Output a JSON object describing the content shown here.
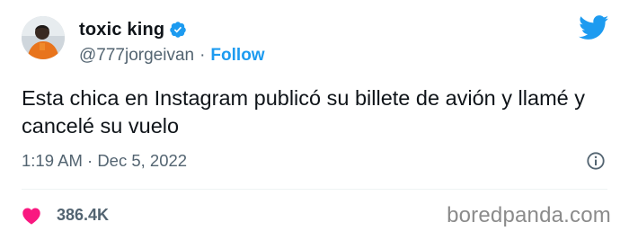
{
  "tweet": {
    "author": {
      "display_name": "toxic king",
      "handle": "@777jorgeivan",
      "separator": "·",
      "follow_label": "Follow",
      "verified": true
    },
    "text": "Esta chica en Instagram publicó su billete de avión y llamé y cancelé su vuelo",
    "meta": "1:19 AM · Dec 5, 2022",
    "likes": "386.4K"
  },
  "watermark": "boredpanda.com",
  "colors": {
    "twitter_blue": "#1d9bf0",
    "heart": "#f91880",
    "secondary_text": "#536471"
  },
  "icons": [
    "twitter-bird-icon",
    "verified-badge-icon",
    "info-icon",
    "heart-icon"
  ]
}
